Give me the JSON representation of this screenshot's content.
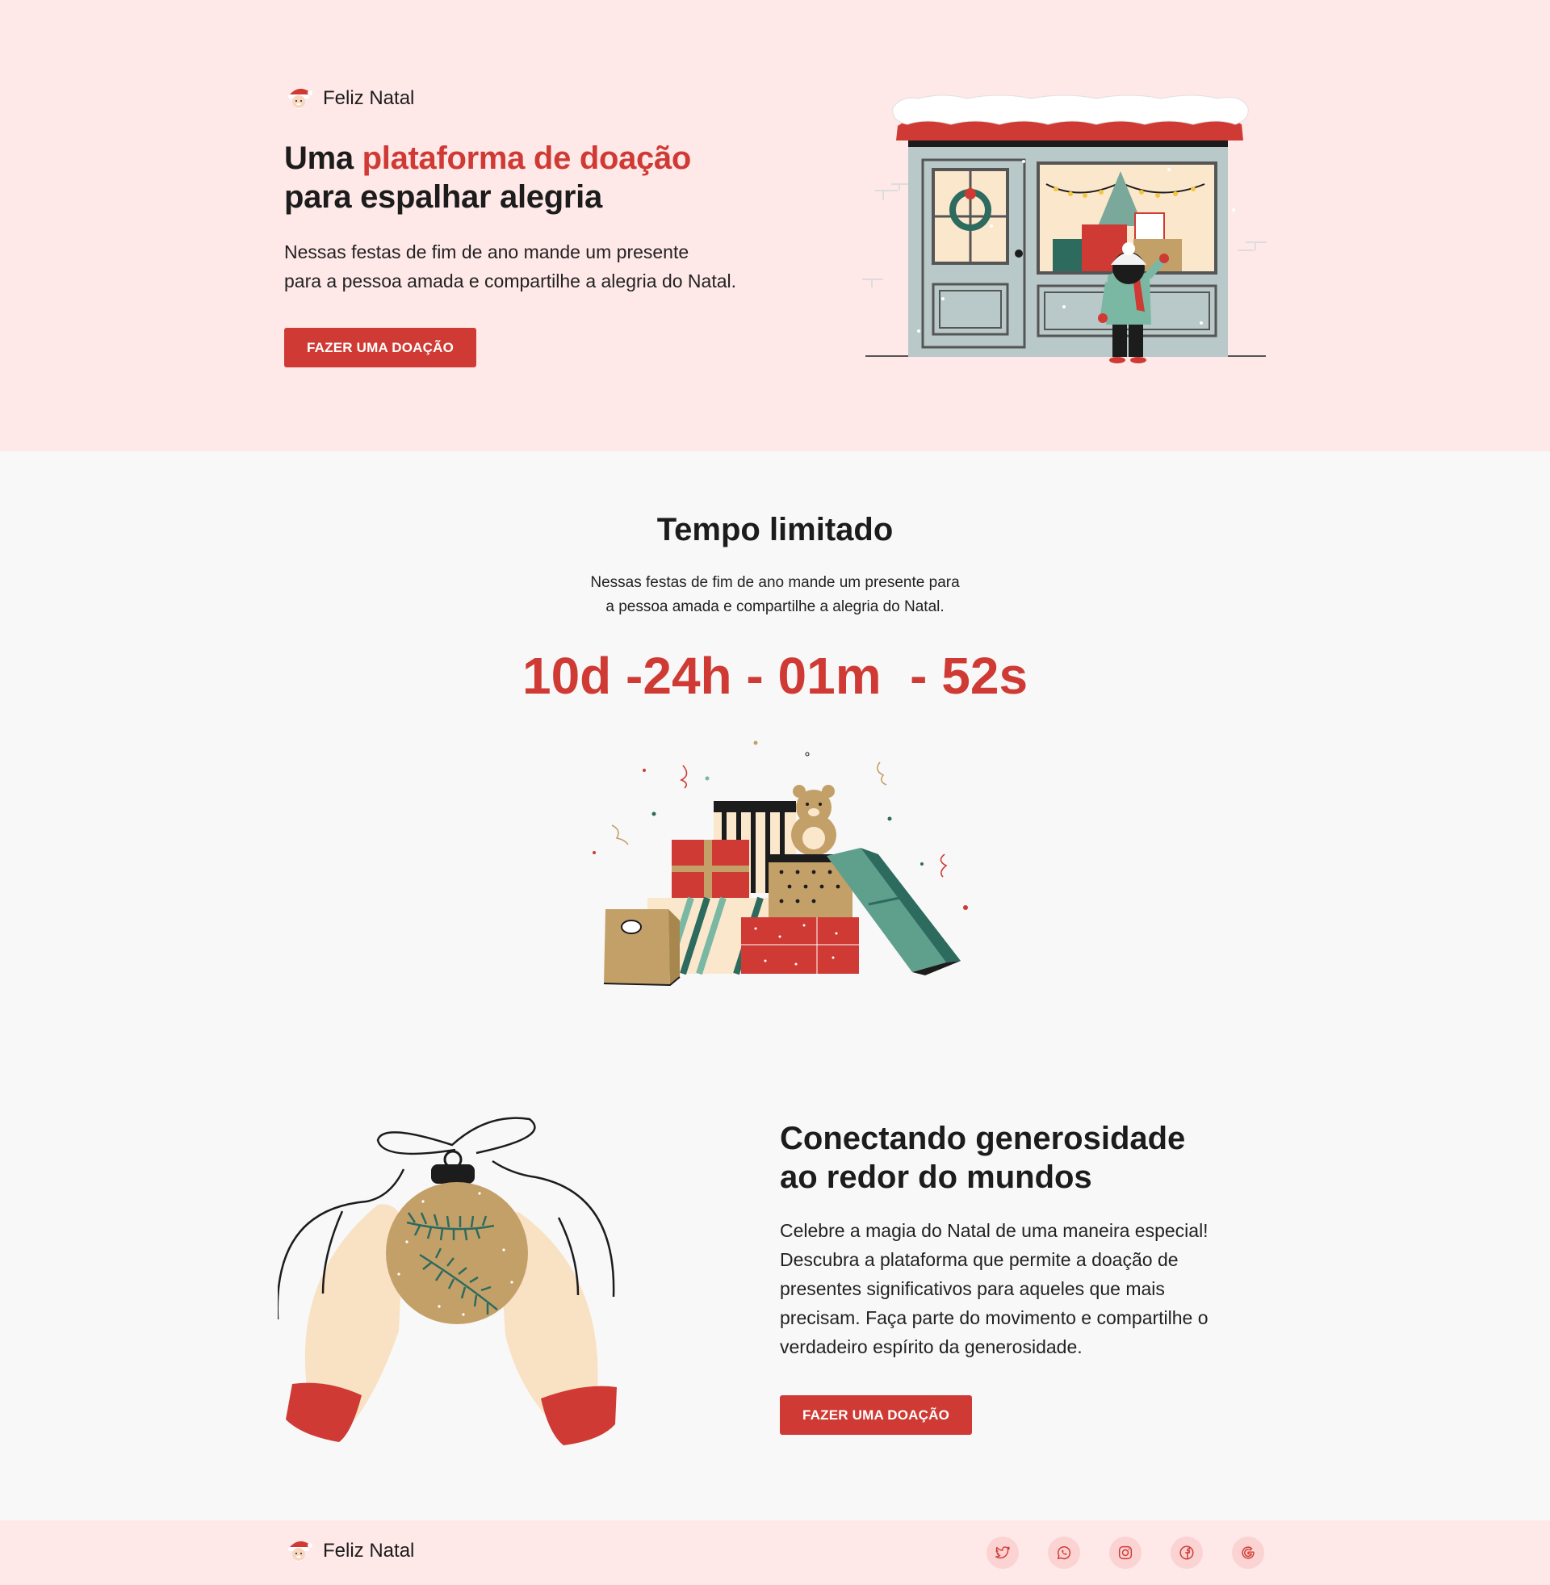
{
  "brand": {
    "name": "Feliz Natal",
    "icon": "santa-icon"
  },
  "hero": {
    "title_prefix": "Uma ",
    "title_highlight": "plataforma de doação",
    "title_suffix": "para espalhar alegria",
    "description_line1": "Nessas festas de fim de ano mande um presente",
    "description_line2": "para a pessoa amada e compartilhe a alegria do Natal.",
    "cta_label": "FAZER UMA DOAÇÃO",
    "illustration": "shop-window-child-illustration"
  },
  "timer": {
    "title": "Tempo limitado",
    "description_line1": "Nessas festas de fim de ano mande um presente para",
    "description_line2": "a pessoa amada e compartilhe a alegria do Natal.",
    "countdown": "10d -24h - 01m  - 52s",
    "illustration": "gift-pile-illustration"
  },
  "generosity": {
    "title_line1": "Conectando generosidade",
    "title_line2": "ao redor do mundos",
    "description": "Celebre a magia do Natal de uma maneira especial! Descubra a plataforma que permite a doação de presentes significativos para aqueles que mais precisam. Faça parte do movimento e compartilhe o verdadeiro espírito da generosidade.",
    "cta_label": "FAZER UMA DOAÇÃO",
    "illustration": "ornament-hands-illustration"
  },
  "footer": {
    "brand_name": "Feliz Natal",
    "socials": [
      "twitter-icon",
      "whatsapp-icon",
      "instagram-icon",
      "facebook-icon",
      "google-icon"
    ]
  },
  "colors": {
    "accent": "#cf3b34",
    "hero_bg": "#ffe8e8",
    "page_bg": "#f8f8f8",
    "social_bg": "#fbd3d3",
    "green": "#2c6b5e",
    "gold": "#c4a069",
    "skin": "#f9e1c4"
  }
}
